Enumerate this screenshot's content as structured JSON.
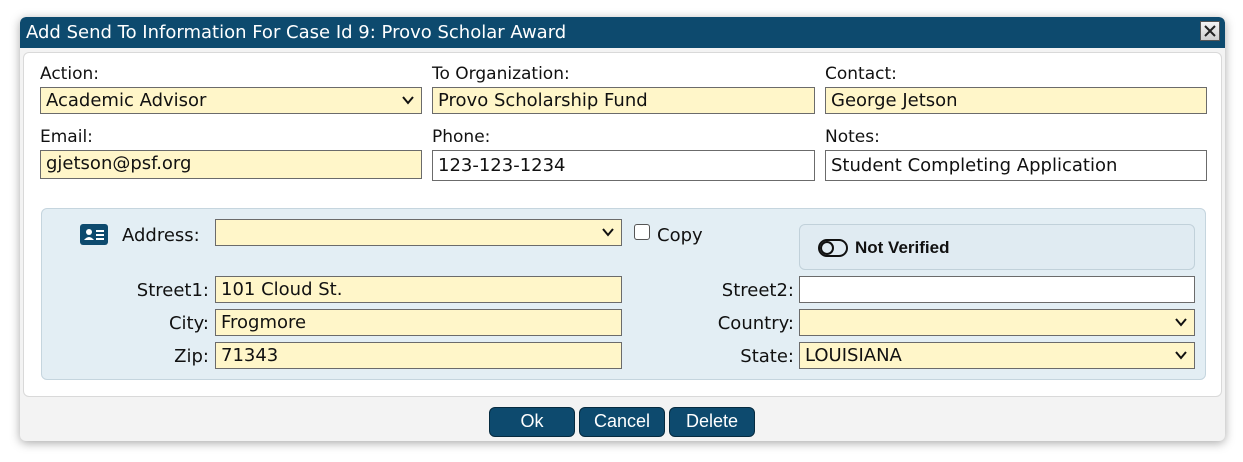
{
  "dialog": {
    "title": "Add Send To Information For Case Id 9: Provo Scholar Award"
  },
  "form": {
    "action": {
      "label": "Action:",
      "value": "Academic Advisor"
    },
    "organization": {
      "label": "To Organization:",
      "value": "Provo Scholarship Fund"
    },
    "contact": {
      "label": "Contact:",
      "value": "George Jetson"
    },
    "email": {
      "label": "Email:",
      "value": "gjetson@psf.org"
    },
    "phone": {
      "label": "Phone:",
      "value": "123-123-1234"
    },
    "notes": {
      "label": "Notes:",
      "value": "Student Completing Application"
    }
  },
  "address": {
    "label": "Address:",
    "value": "",
    "copy_label": "Copy",
    "verification_status": "Not Verified",
    "street1": {
      "label": "Street1:",
      "value": "101 Cloud St."
    },
    "street2": {
      "label": "Street2:",
      "value": ""
    },
    "city": {
      "label": "City:",
      "value": "Frogmore"
    },
    "country": {
      "label": "Country:",
      "value": ""
    },
    "zip": {
      "label": "Zip:",
      "value": "71343"
    },
    "state": {
      "label": "State:",
      "value": "LOUISIANA"
    }
  },
  "buttons": {
    "ok": "Ok",
    "cancel": "Cancel",
    "delete": "Delete"
  },
  "colors": {
    "titlebar": "#0d4a6e",
    "field_highlight": "#fff6c9",
    "address_panel": "#e3eef4"
  }
}
